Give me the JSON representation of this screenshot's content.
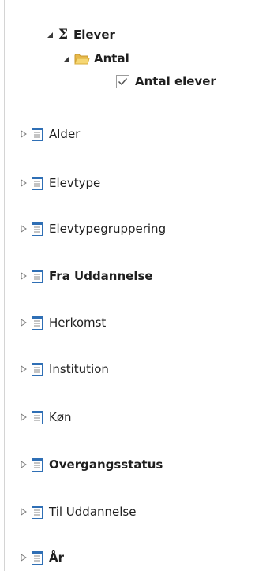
{
  "tree": {
    "measure_group": {
      "label": "Elever",
      "icon": "sigma-icon",
      "expanded": true
    },
    "folder": {
      "label": "Antal",
      "icon": "folder-icon",
      "expanded": true
    },
    "measure": {
      "label": "Antal elever",
      "checked": true
    },
    "dimensions": [
      {
        "label": "Alder",
        "bold": false
      },
      {
        "label": "Elevtype",
        "bold": false
      },
      {
        "label": "Elevtypegruppering",
        "bold": false
      },
      {
        "label": "Fra Uddannelse",
        "bold": true
      },
      {
        "label": "Herkomst",
        "bold": false
      },
      {
        "label": "Institution",
        "bold": false
      },
      {
        "label": "Køn",
        "bold": false
      },
      {
        "label": "Overgangsstatus",
        "bold": true
      },
      {
        "label": "Til Uddannelse",
        "bold": false
      },
      {
        "label": "År",
        "bold": true
      }
    ]
  },
  "colors": {
    "dimension_icon_blue": "#2f6fb5",
    "folder_yellow": "#f2c94c",
    "triangle_gray": "#7a7a7a"
  }
}
